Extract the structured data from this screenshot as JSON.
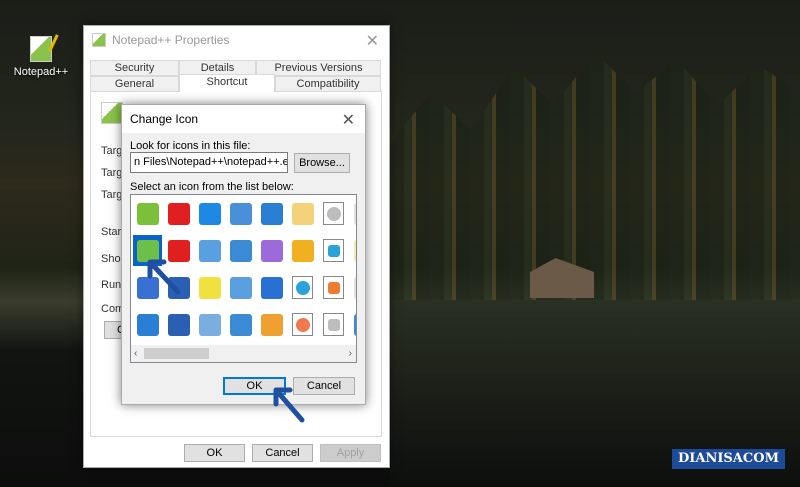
{
  "desktop": {
    "icon_label": "Notepad++"
  },
  "properties": {
    "title": "Notepad++ Properties",
    "tabs_row1": [
      "Security",
      "Details",
      "Previous Versions"
    ],
    "tabs_row2": [
      "General",
      "Shortcut",
      "Compatibility"
    ],
    "selected_tab": "Shortcut",
    "partial_labels": [
      "Targ",
      "Targ",
      "Targ",
      "Start",
      "Short",
      "Run:",
      "Comm",
      "C"
    ],
    "buttons": {
      "ok": "OK",
      "cancel": "Cancel",
      "apply": "Apply"
    }
  },
  "change_icon": {
    "title": "Change Icon",
    "file_label": "Look for icons in this file:",
    "file_value": "n Files\\Notepad++\\notepad++.exe",
    "browse": "Browse...",
    "list_label": "Select an icon from the list below:",
    "ok": "OK",
    "cancel": "Cancel",
    "icons": [
      {
        "name": "notepad-icon",
        "color": "#7cbf3a"
      },
      {
        "name": "delete-doc-icon",
        "color": "#e02020"
      },
      {
        "name": "cut-icon",
        "color": "#1e88e5"
      },
      {
        "name": "redo-icon",
        "color": "#4a90d9"
      },
      {
        "name": "find-icon",
        "color": "#2a7fd4"
      },
      {
        "name": "notes-icon",
        "color": "#f3d27a"
      },
      {
        "name": "grey-circle-icon",
        "color": "#bdbdbd"
      },
      {
        "name": "partial-icon",
        "color": "#e0e0e0"
      },
      {
        "name": "chameleon-icon",
        "color": "#6cc04a",
        "selected": true
      },
      {
        "name": "close-all-icon",
        "color": "#e02020"
      },
      {
        "name": "save-doc-icon",
        "color": "#5a9fe0"
      },
      {
        "name": "find-doc-icon",
        "color": "#3a8ad4"
      },
      {
        "name": "doc-map-icon",
        "color": "#9c6ad9"
      },
      {
        "name": "sync-icon",
        "color": "#f0b020"
      },
      {
        "name": "blue-square-icon",
        "color": "#29a3d9"
      },
      {
        "name": "partial-icon",
        "color": "#f5e9b0"
      },
      {
        "name": "edit-doc-icon",
        "color": "#3a6fd4"
      },
      {
        "name": "save-icon",
        "color": "#2a5fb4"
      },
      {
        "name": "highlight-doc-icon",
        "color": "#f0e040"
      },
      {
        "name": "pen-find-icon",
        "color": "#5aa0e0"
      },
      {
        "name": "print-folder-icon",
        "color": "#2a6fd4"
      },
      {
        "name": "blue-circle-icon",
        "color": "#29a3d9"
      },
      {
        "name": "orange-square-icon",
        "color": "#f07a30"
      },
      {
        "name": "partial-icon",
        "color": "#e0e0e0"
      },
      {
        "name": "folder-open-icon",
        "color": "#2a7fd4"
      },
      {
        "name": "save-all-icon",
        "color": "#2a5fb4"
      },
      {
        "name": "undo-icon",
        "color": "#7aaee0"
      },
      {
        "name": "zoom-in-icon",
        "color": "#3a8ad4"
      },
      {
        "name": "pilcrow-icon",
        "color": "#f0a030"
      },
      {
        "name": "orange-circle-icon",
        "color": "#f07a50"
      },
      {
        "name": "grey-square-icon",
        "color": "#bdbdbd"
      },
      {
        "name": "partial-icon",
        "color": "#3a8ad4"
      }
    ]
  },
  "watermark": "DIANISACOM",
  "colors": {
    "accent": "#0078d7",
    "annotation": "#1f4fa0"
  }
}
